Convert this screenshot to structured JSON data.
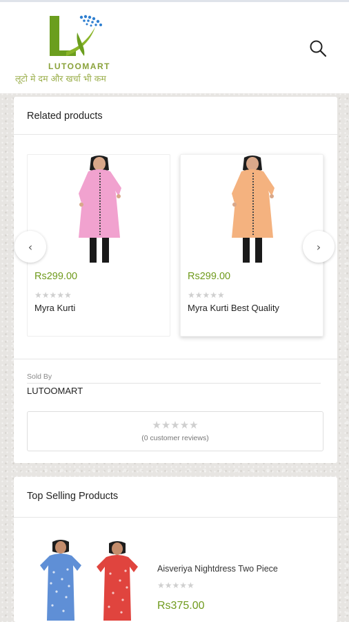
{
  "header": {
    "logo_name": "LUTOOMART",
    "logo_tagline": "लूटो मे दम और खर्चा भी कम",
    "search_icon": "search-icon"
  },
  "related": {
    "title": "Related products",
    "prev_icon": "chevron-left-icon",
    "next_icon": "chevron-right-icon",
    "products": [
      {
        "price": "Rs299.00",
        "rating": "★★★★★",
        "name": "Myra Kurti",
        "kurti_color": "#f1a2cf"
      },
      {
        "price": "Rs299.00",
        "rating": "★★★★★",
        "name": "Myra Kurti Best Quality",
        "kurti_color": "#f4b27f"
      }
    ]
  },
  "seller": {
    "label": "Sold By",
    "name": "LUTOOMART"
  },
  "reviews": {
    "stars": "★★★★★",
    "count_text": "(0 customer reviews)"
  },
  "top_selling": {
    "title": "Top Selling Products",
    "item": {
      "name": "Aisveriya Nightdress Two Piece",
      "rating": "★★★★★",
      "price": "Rs375.00"
    }
  },
  "colors": {
    "price_green": "#6f9a1c",
    "brand_green": "#6b9e1e",
    "logo_blue": "#2f7fd0"
  }
}
